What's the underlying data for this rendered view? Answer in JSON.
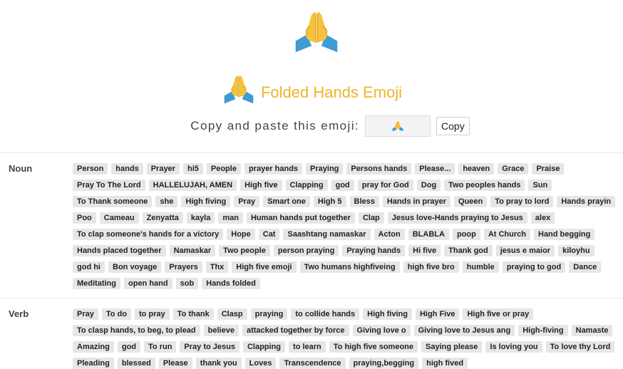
{
  "emoji": {
    "title": "Folded Hands Emoji",
    "copy_label": "Copy and paste this emoji:",
    "copy_value": "🙏",
    "copy_button": "Copy",
    "colors": {
      "title": "#f0b429",
      "skin": "#f5c23a",
      "skin_shade": "#e0a020",
      "sleeve": "#3f9ad6",
      "tag_bg": "#e6e6e6"
    },
    "icon": "folded-hands-icon"
  },
  "sections": {
    "noun": {
      "label": "Noun",
      "tags": [
        "Person",
        "hands",
        "Prayer",
        "hi5",
        "People",
        "prayer hands",
        "Praying",
        "Persons hands",
        "Please...",
        "heaven",
        "Grace",
        "Praise",
        "Pray To The Lord",
        "HALLELUJAH, AMEN",
        "High five",
        "Clapping",
        "god",
        "pray for God",
        "Dog",
        "Two peoples hands",
        "Sun",
        "To Thank someone",
        "she",
        "High fiving",
        "Pray",
        "Smart one",
        "High 5",
        "Bless",
        "Hands in prayer",
        "Queen",
        "To pray to lord",
        "Hands prayin",
        "Poo",
        "Cameau",
        "Zenyatta",
        "kayla",
        "man",
        "Human hands put together",
        "Clap",
        "Jesus love-Hands praying to Jesus",
        "alex",
        "To clap someone's hands for a victory",
        "Hope",
        "Cat",
        "Saashtang namaskar",
        "Acton",
        "BLABLA",
        "poop",
        "At Church",
        "Hand begging",
        "Hands placed together",
        "Namaskar",
        "Two people",
        "person praying",
        "Praying hands",
        "Hi five",
        "Thank god",
        "jesus e maior",
        "kiloyhu",
        "god hi",
        "Bon voyage",
        "Prayers",
        "Thx",
        "High five emoji",
        "Two humans highfiveing",
        "high five bro",
        "humble",
        "praying to god",
        "Dance",
        "Meditating",
        "open hand",
        "sob",
        "Hands folded"
      ]
    },
    "verb": {
      "label": "Verb",
      "tags": [
        "Pray",
        "To do",
        "to pray",
        "To thank",
        "Clasp",
        "praying",
        "to collide hands",
        "High fiving",
        "High Five",
        "High five or pray",
        "To clasp hands, to beg, to plead",
        "believe",
        "attacked together by force",
        "Giving love o",
        "Giving love to Jesus ang",
        "High-fiving",
        "Namaste",
        "Amazing",
        "god",
        "To run",
        "Pray to Jesus",
        "Clapping",
        "to learn",
        "To high five someone",
        "Saying please",
        "Is loving you",
        "To love thy Lord",
        "Pleading",
        "blessed",
        "Please",
        "thank you",
        "Loves",
        "Transcendence",
        "praying,begging",
        "high fived"
      ]
    }
  }
}
